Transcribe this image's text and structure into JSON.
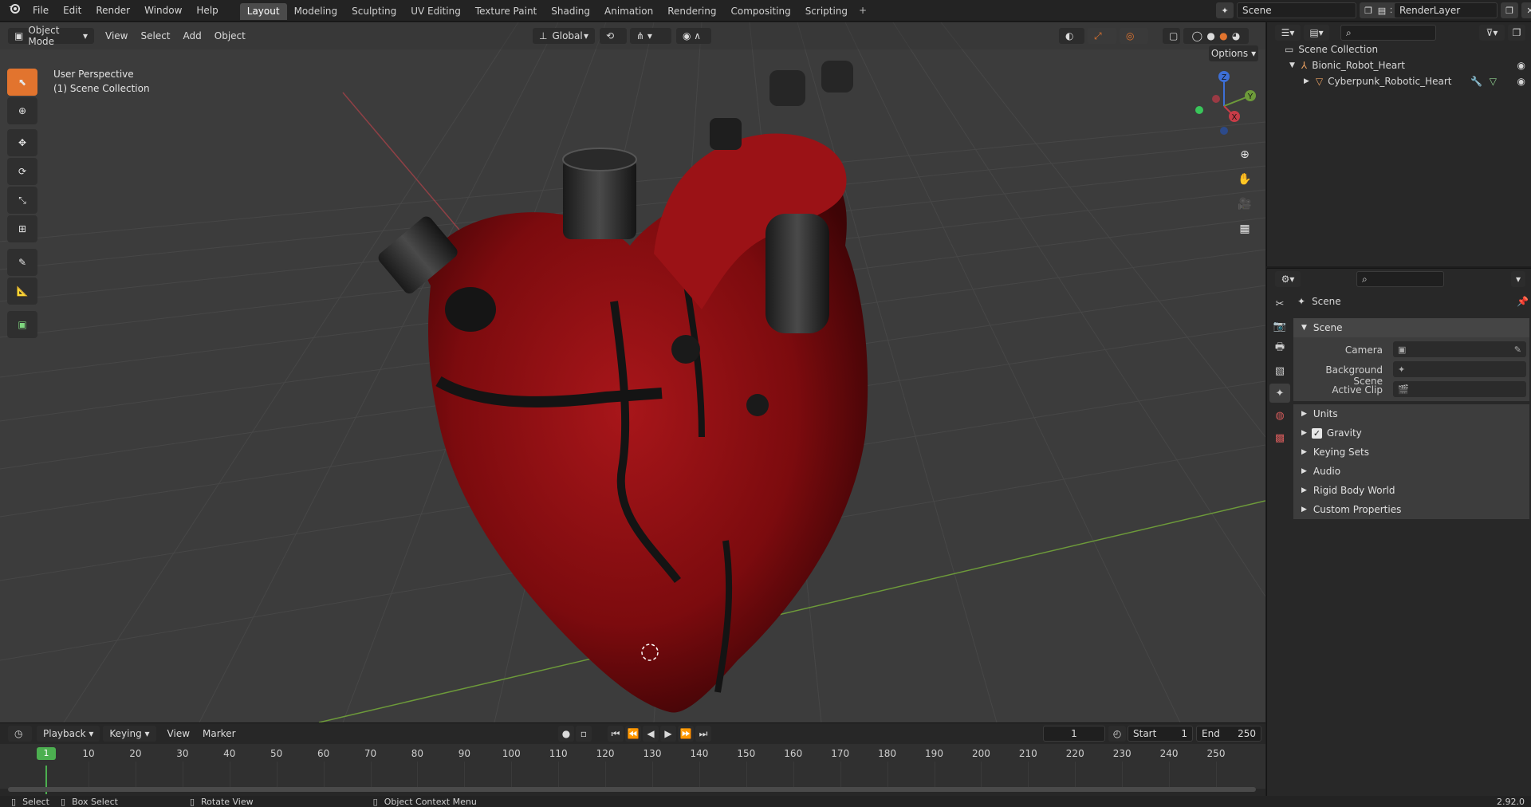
{
  "topbar": {
    "menus": [
      "File",
      "Edit",
      "Render",
      "Window",
      "Help"
    ],
    "workspaces": [
      "Layout",
      "Modeling",
      "Sculpting",
      "UV Editing",
      "Texture Paint",
      "Shading",
      "Animation",
      "Rendering",
      "Compositing",
      "Scripting"
    ],
    "active_workspace": "Layout",
    "scene_name": "Scene",
    "view_layer": "RenderLayer"
  },
  "viewport": {
    "mode": "Object Mode",
    "menus": [
      "View",
      "Select",
      "Add",
      "Object"
    ],
    "transform_orientation": "Global",
    "options_label": "Options",
    "overlay_title": "User Perspective",
    "overlay_collection": "(1) Scene Collection",
    "gizmo_axes": {
      "x": "X",
      "y": "Y",
      "z": "Z"
    }
  },
  "outliner": {
    "root": "Scene Collection",
    "items": [
      {
        "name": "Bionic_Robot_Heart",
        "level": 1
      },
      {
        "name": "Cyberpunk_Robotic_Heart",
        "level": 2
      }
    ]
  },
  "properties": {
    "context": "Scene",
    "panel_title": "Scene",
    "fields": [
      {
        "label": "Camera",
        "value": ""
      },
      {
        "label": "Background Scene",
        "value": ""
      },
      {
        "label": "Active Clip",
        "value": ""
      }
    ],
    "subpanels": [
      "Units",
      "Gravity",
      "Keying Sets",
      "Audio",
      "Rigid Body World",
      "Custom Properties"
    ],
    "gravity_checked": true
  },
  "timeline": {
    "menus": [
      "Playback",
      "Keying",
      "View",
      "Marker"
    ],
    "current_frame": "1",
    "start_label": "Start",
    "start": "1",
    "end_label": "End",
    "end": "250",
    "ticks": [
      "1",
      "10",
      "20",
      "30",
      "40",
      "50",
      "60",
      "70",
      "80",
      "90",
      "100",
      "110",
      "120",
      "130",
      "140",
      "150",
      "160",
      "170",
      "180",
      "190",
      "200",
      "210",
      "220",
      "230",
      "240",
      "250"
    ]
  },
  "statusbar": {
    "items": [
      "Select",
      "Box Select",
      "Rotate View",
      "Object Context Menu"
    ],
    "version": "2.92.0"
  },
  "colors": {
    "accent": "#e2742e",
    "heart": "#8e0d10",
    "grid_line": "#474747",
    "x_axis": "#b3424a",
    "y_axis": "#6d9a3a",
    "frame_marker": "#4caf50"
  }
}
